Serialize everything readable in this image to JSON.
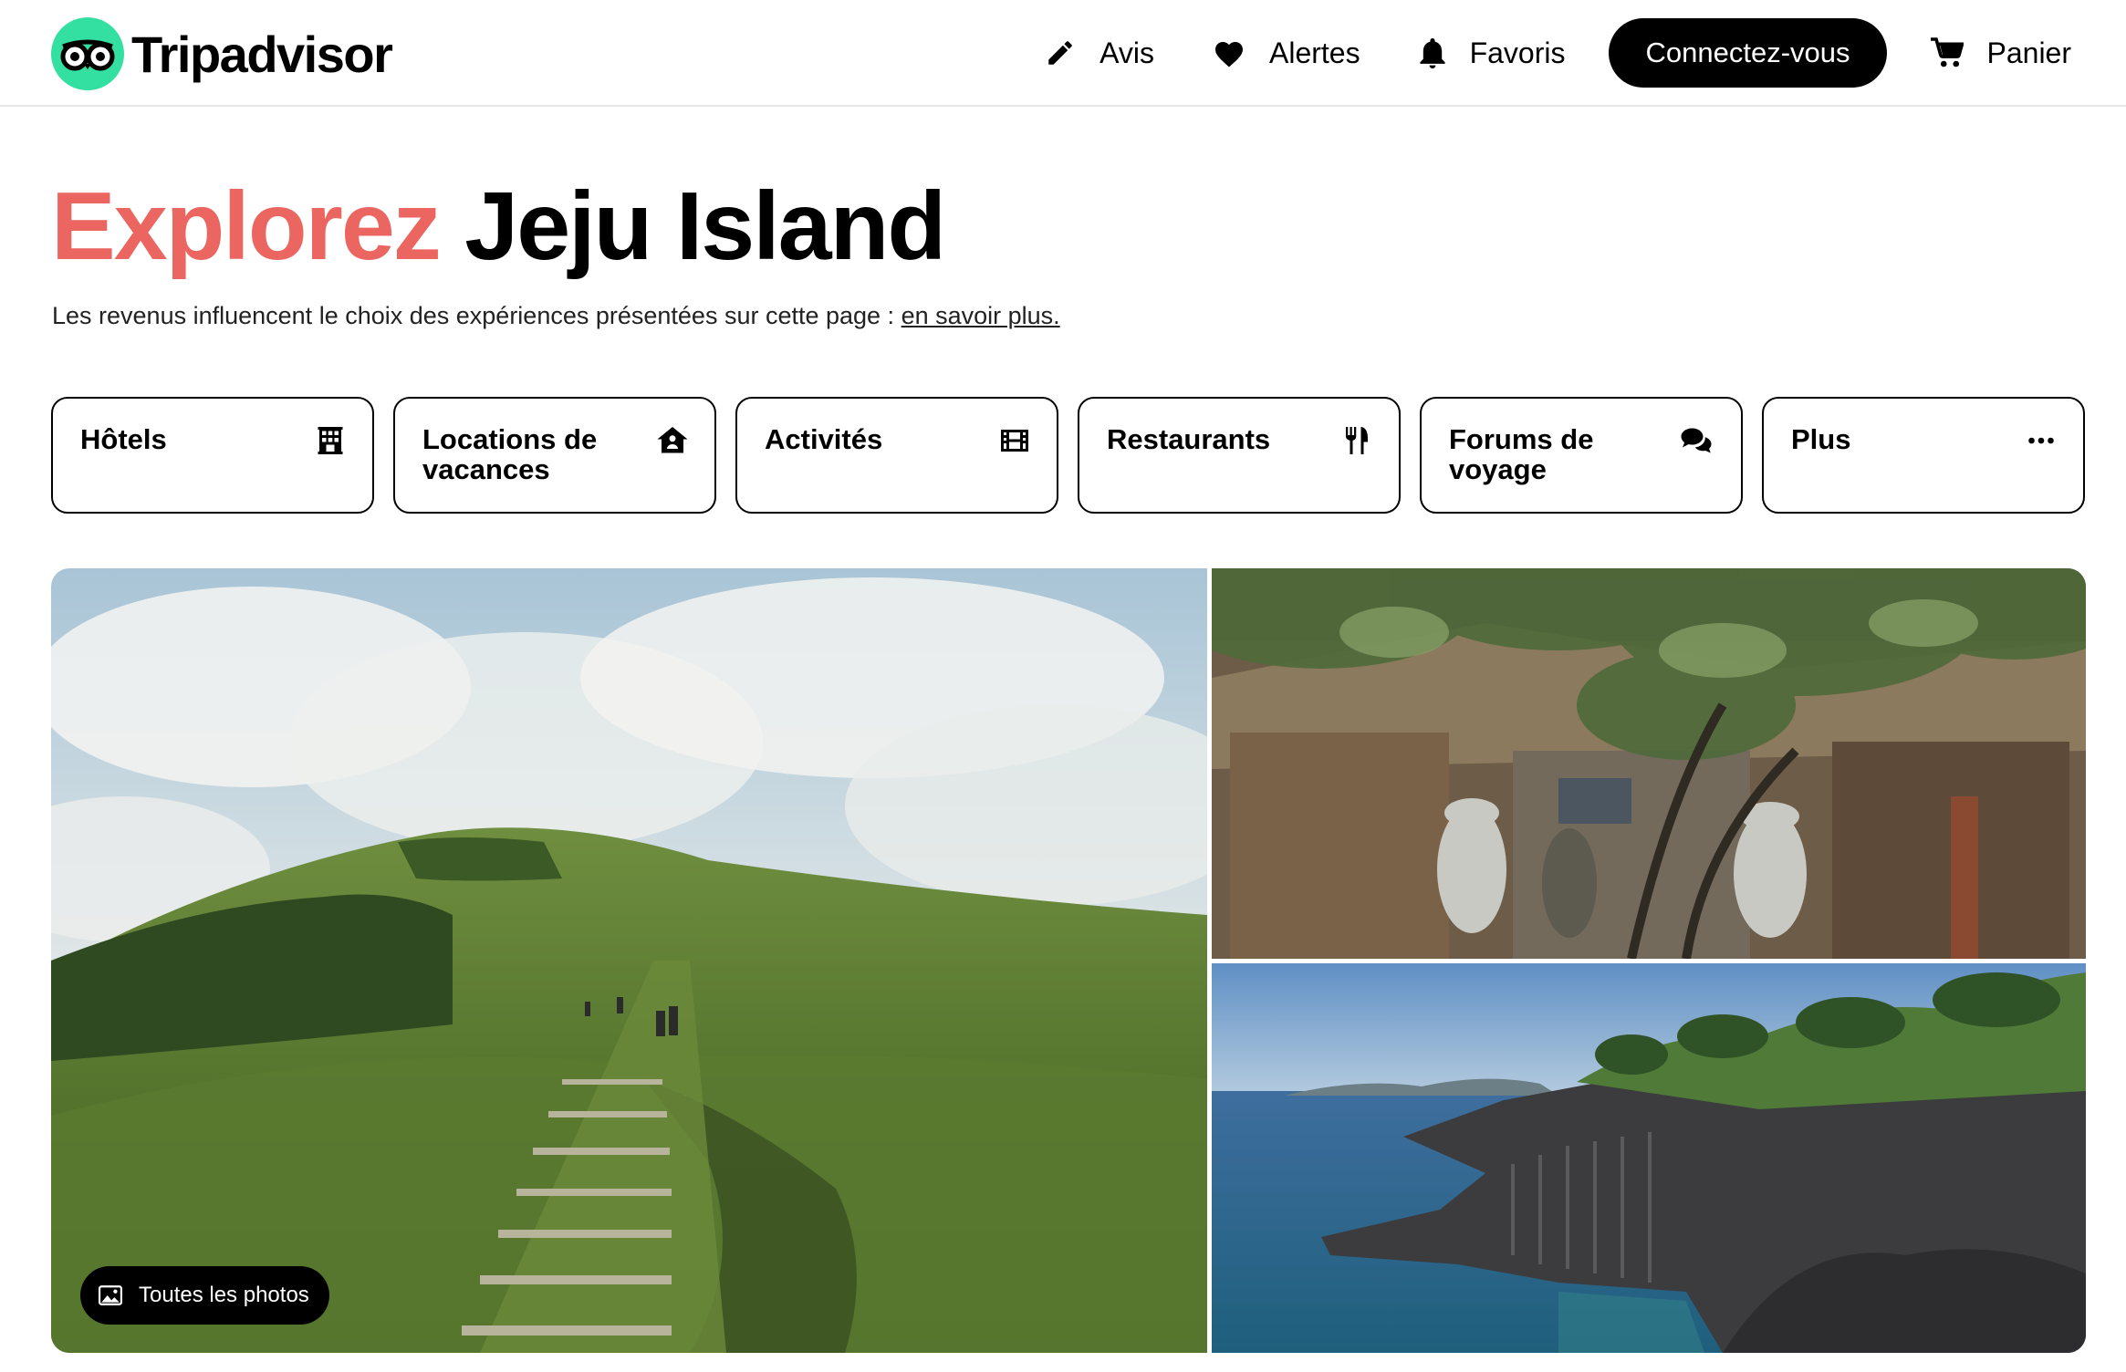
{
  "brand": {
    "name": "Tripadvisor",
    "accent": "#34e0a1"
  },
  "nav": {
    "reviews": "Avis",
    "alerts": "Alertes",
    "favorites": "Favoris",
    "connect": "Connectez-vous",
    "cart": "Panier"
  },
  "title": {
    "accent": "Explorez",
    "place": "Jeju Island",
    "accent_color": "#ec6661"
  },
  "disclosure": {
    "text": "Les revenus influencent le choix des expériences présentées sur cette page : ",
    "link": "en savoir plus."
  },
  "categories": [
    {
      "label": "Hôtels",
      "icon": "hotel-icon"
    },
    {
      "label": "Locations de\nvacances",
      "icon": "house-icon"
    },
    {
      "label": "Activités",
      "icon": "ticket-icon"
    },
    {
      "label": "Restaurants",
      "icon": "fork-knife-icon"
    },
    {
      "label": "Forums de\nvoyage",
      "icon": "chat-bubbles-icon"
    },
    {
      "label": "Plus",
      "icon": "more-dots-icon"
    }
  ],
  "gallery": {
    "all_photos": "Toutes les photos"
  }
}
